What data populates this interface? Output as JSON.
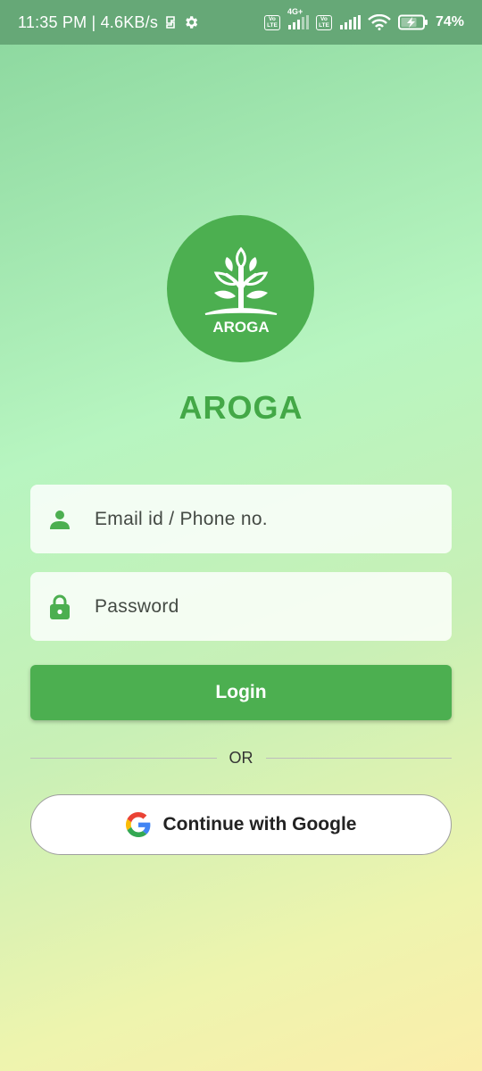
{
  "status_bar": {
    "time_speed": "11:35 PM | 4.6KB/s",
    "volte_label_top": "Vo",
    "volte_label_bottom": "LTE",
    "network_tag": "4G+",
    "battery_percent": "74%"
  },
  "app": {
    "logo_text": "AROGA",
    "title": "AROGA"
  },
  "form": {
    "email_placeholder": "Email id / Phone no.",
    "password_placeholder": "Password",
    "login_label": "Login",
    "divider_text": "OR",
    "google_label": "Continue with Google"
  },
  "colors": {
    "primary": "#4caf50",
    "title": "#43a847",
    "status_bar": "#66a877"
  },
  "icons": [
    "person-icon",
    "lock-icon",
    "google-icon",
    "settings-icon",
    "wifi-icon",
    "battery-icon"
  ]
}
